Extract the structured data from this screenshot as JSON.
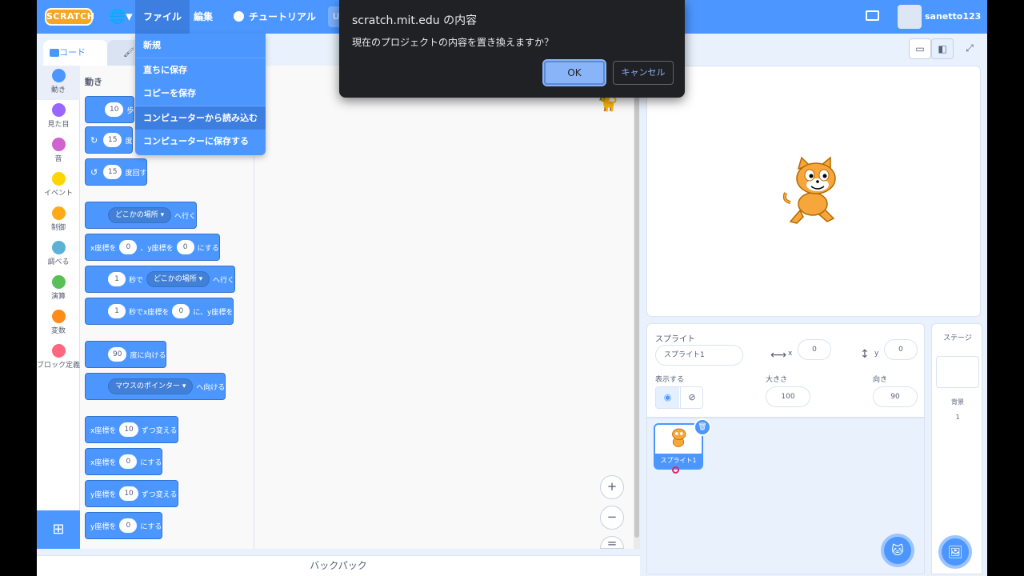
{
  "menubar": {
    "logo": "SCRATCH",
    "file_menu": "ファイル",
    "edit_menu": "編集",
    "tutorials": "チュートリアル",
    "title_stub": "U",
    "username": "sanetto123"
  },
  "file_dropdown": {
    "items": [
      "新規",
      "直ちに保存",
      "コピーを保存",
      "コンピューターから読み込む",
      "コンピューターに保存する"
    ]
  },
  "dialog": {
    "title": "scratch.mit.edu の内容",
    "message": "現在のプロジェクトの内容を置き換えますか？",
    "ok": "OK",
    "cancel": "キャンセル"
  },
  "tabs": {
    "code": "コード"
  },
  "categories": [
    {
      "label": "動き",
      "color": "#4c97ff"
    },
    {
      "label": "見た目",
      "color": "#9966ff"
    },
    {
      "label": "音",
      "color": "#cf63cf"
    },
    {
      "label": "イベント",
      "color": "#ffd500"
    },
    {
      "label": "制御",
      "color": "#ffab19"
    },
    {
      "label": "調べる",
      "color": "#5cb1d6"
    },
    {
      "label": "演算",
      "color": "#59c059"
    },
    {
      "label": "変数",
      "color": "#ff8c1a"
    },
    {
      "label": "ブロック定義",
      "color": "#ff6680"
    }
  ],
  "palette": {
    "heading": "動き",
    "blocks": {
      "move_val": "10",
      "move_suffix": "歩",
      "turn_right_val": "15",
      "turn_right_suffix": "度",
      "turn_left_val": "15",
      "turn_left_suffix": "度回す",
      "goto_drop": "どこかの場所",
      "goto_suffix": "へ行く",
      "gotoxy_x_label": "x座標を",
      "gotoxy_x": "0",
      "gotoxy_y_label": "、y座標を",
      "gotoxy_y": "0",
      "gotoxy_suffix": "にする",
      "glide_val": "1",
      "glide_mid": "秒で",
      "glide_drop": "どこかの場所",
      "glide_suffix": "へ行く",
      "glidexy_val": "1",
      "glidexy_mid": "秒でx座標を",
      "glidexy_x": "0",
      "glidexy_y_label": "に、y座標を",
      "point_val": "90",
      "point_suffix": "度に向ける",
      "pointto_drop": "マウスのポインター",
      "pointto_suffix": "へ向ける",
      "changex_label": "x座標を",
      "changex_val": "10",
      "changex_suffix": "ずつ変える",
      "setx_label": "x座標を",
      "setx_val": "0",
      "setx_suffix": "にする",
      "changey_label": "y座標を",
      "changey_val": "10",
      "changey_suffix": "ずつ変える",
      "sety_label": "y座標を",
      "sety_val": "0",
      "sety_suffix": "にする"
    }
  },
  "backpack": "バックパック",
  "sprite_info": {
    "sprite_label": "スプライト",
    "sprite_name": "スプライト1",
    "x_label": "x",
    "x_value": "0",
    "y_label": "y",
    "y_value": "0",
    "show_label": "表示する",
    "size_label": "大きさ",
    "size_value": "100",
    "direction_label": "向き",
    "direction_value": "90"
  },
  "sprite_list": {
    "items": [
      {
        "name": "スプライト1"
      }
    ]
  },
  "stage_pane": {
    "title": "ステージ",
    "backdrops_label": "背景",
    "backdrops_count": "1"
  }
}
